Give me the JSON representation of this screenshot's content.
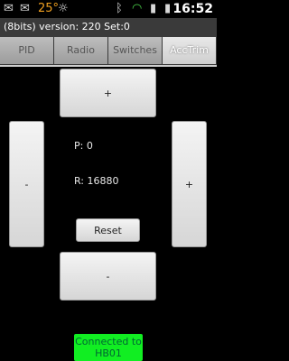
{
  "statusbar": {
    "temperature": "25°",
    "time": "16:52",
    "icons": [
      "mail-icon",
      "gmail-icon",
      "temperature-text",
      "sun-icon",
      "bluetooth-icon",
      "wifi-icon",
      "signal-icon",
      "battery-icon"
    ]
  },
  "title": "(8bits) version: 220   Set:0",
  "tabs": [
    {
      "label": "PID",
      "active": false
    },
    {
      "label": "Radio",
      "active": false
    },
    {
      "label": "Switches",
      "active": false
    },
    {
      "label": "AccTrim",
      "active": true
    }
  ],
  "controls": {
    "top_plus": "+",
    "left_minus": "-",
    "right_plus": "+",
    "bottom_minus": "-",
    "reset": "Reset"
  },
  "readouts": {
    "p": "P: 0",
    "r": "R: 16880"
  },
  "connection": {
    "text": "Connected to HB01",
    "color": "#11ee22"
  }
}
